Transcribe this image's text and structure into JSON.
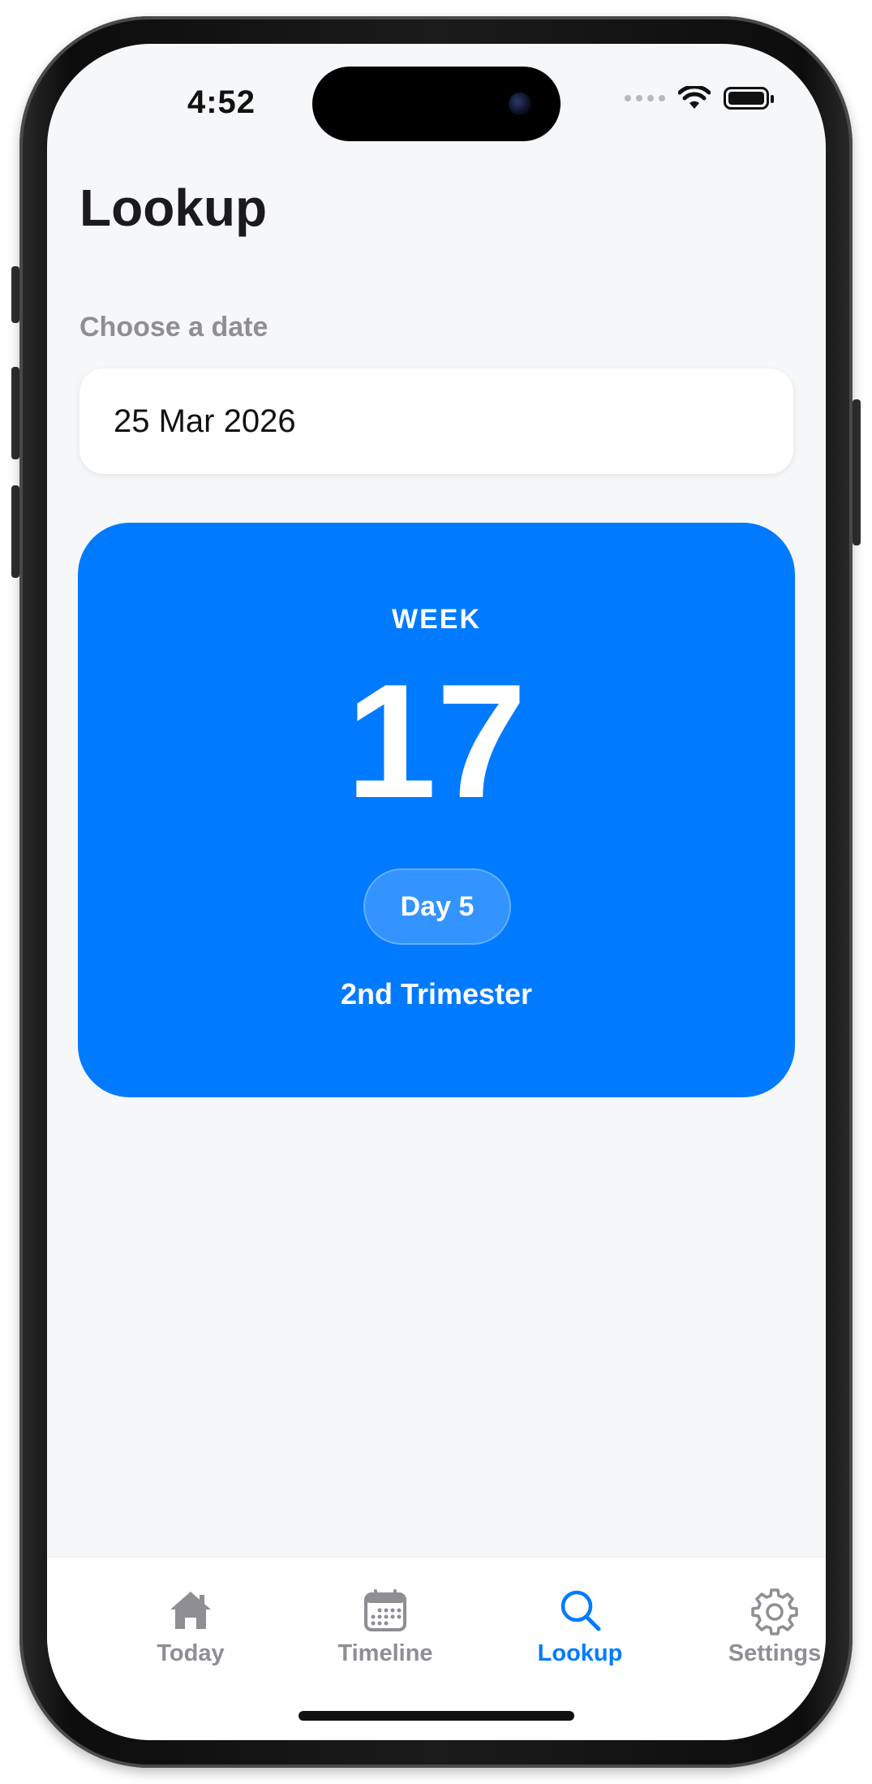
{
  "status_bar": {
    "time": "4:52",
    "icons": [
      "signal-dots-icon",
      "wifi-icon",
      "battery-icon"
    ]
  },
  "header": {
    "title": "Lookup"
  },
  "date_picker": {
    "label": "Choose a date",
    "value": "25 Mar 2026"
  },
  "week_card": {
    "label": "WEEK",
    "week": "17",
    "day": "Day 5",
    "trimester": "2nd Trimester",
    "color": "#007aff"
  },
  "tab_bar": {
    "items": [
      {
        "label": "Today",
        "icon": "home-icon",
        "active": false
      },
      {
        "label": "Timeline",
        "icon": "calendar-icon",
        "active": false
      },
      {
        "label": "Lookup",
        "icon": "search-icon",
        "active": true
      },
      {
        "label": "Settings",
        "icon": "gear-icon",
        "active": false
      }
    ],
    "active_color": "#007aff",
    "inactive_color": "#8e8e93"
  }
}
